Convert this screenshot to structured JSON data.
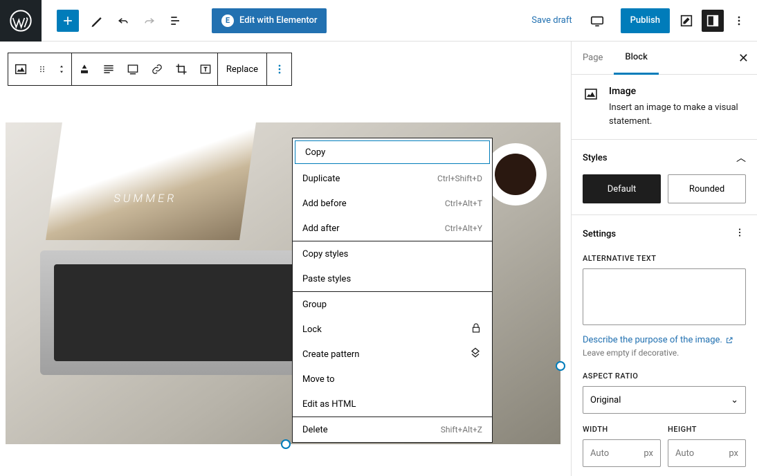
{
  "topbar": {
    "elementor_label": "Edit with Elementor",
    "save_draft": "Save draft",
    "publish": "Publish"
  },
  "block_toolbar": {
    "replace": "Replace"
  },
  "context_menu": {
    "copy": "Copy",
    "duplicate": "Duplicate",
    "duplicate_kb": "Ctrl+Shift+D",
    "add_before": "Add before",
    "add_before_kb": "Ctrl+Alt+T",
    "add_after": "Add after",
    "add_after_kb": "Ctrl+Alt+Y",
    "copy_styles": "Copy styles",
    "paste_styles": "Paste styles",
    "group": "Group",
    "lock": "Lock",
    "create_pattern": "Create pattern",
    "move_to": "Move to",
    "edit_html": "Edit as HTML",
    "delete": "Delete",
    "delete_kb": "Shift+Alt+Z"
  },
  "sidebar": {
    "tabs": {
      "page": "Page",
      "block": "Block"
    },
    "block_info": {
      "title": "Image",
      "desc": "Insert an image to make a visual statement."
    },
    "styles": {
      "title": "Styles",
      "default": "Default",
      "rounded": "Rounded"
    },
    "settings": {
      "title": "Settings",
      "alt_label": "ALTERNATIVE TEXT",
      "alt_value": "",
      "alt_link": "Describe the purpose of the image.",
      "alt_help": "Leave empty if decorative.",
      "aspect_label": "ASPECT RATIO",
      "aspect_value": "Original",
      "width_label": "WIDTH",
      "width_placeholder": "Auto",
      "width_unit": "px",
      "height_label": "HEIGHT",
      "height_placeholder": "Auto",
      "height_unit": "px"
    }
  },
  "magazine_text": "SUMMER"
}
